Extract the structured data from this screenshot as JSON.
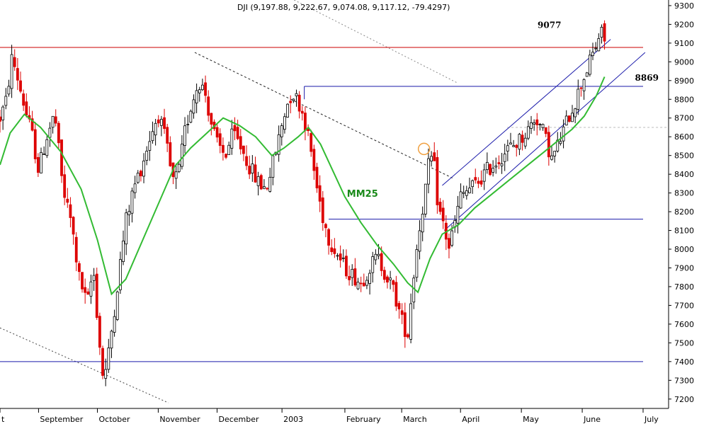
{
  "chart_data": {
    "type": "candlestick",
    "title": "DJI (9,197.88, 9,222.67, 9,074.08, 9,117.12, -79.4297)",
    "ylim": [
      7150,
      9330
    ],
    "y_ticks": [
      7200,
      7300,
      7400,
      7500,
      7600,
      7700,
      7800,
      7900,
      8000,
      8100,
      8200,
      8300,
      8400,
      8500,
      8600,
      8700,
      8800,
      8900,
      9000,
      9100,
      9200,
      9300
    ],
    "x_tick_labels": [
      "t",
      "September",
      "October",
      "November",
      "December",
      "2003",
      "February",
      "March",
      "April",
      "May",
      "June",
      "July"
    ],
    "x_tick_days": [
      0,
      19,
      48,
      78,
      107,
      139,
      170,
      198,
      227,
      257,
      287,
      317
    ],
    "last_day": 298,
    "grid_y": [
      8650
    ],
    "candles_bars": 207,
    "horizontal_levels": [
      {
        "value": 9077,
        "label": "9077",
        "color": "#cc0000",
        "from_day": 0,
        "to_day": 317
      },
      {
        "value": 8869,
        "label": "8869",
        "color": "#1a1aaa",
        "from_day": 150,
        "to_day": 317
      },
      {
        "value": 8160,
        "label": "",
        "color": "#1a1aaa",
        "from_day": 162,
        "to_day": 317
      },
      {
        "value": 7400,
        "label": "",
        "color": "#1a1aaa",
        "from_day": 0,
        "to_day": 317
      }
    ],
    "moving_average_label": "MM25",
    "moving_average_color": "#33bb33",
    "moving_average": [
      [
        0,
        8450
      ],
      [
        5,
        8620
      ],
      [
        12,
        8720
      ],
      [
        20,
        8650
      ],
      [
        30,
        8520
      ],
      [
        40,
        8320
      ],
      [
        48,
        8050
      ],
      [
        55,
        7760
      ],
      [
        62,
        7840
      ],
      [
        70,
        8040
      ],
      [
        78,
        8240
      ],
      [
        86,
        8440
      ],
      [
        94,
        8540
      ],
      [
        102,
        8620
      ],
      [
        110,
        8700
      ],
      [
        118,
        8660
      ],
      [
        126,
        8600
      ],
      [
        134,
        8500
      ],
      [
        140,
        8540
      ],
      [
        147,
        8600
      ],
      [
        152,
        8650
      ],
      [
        158,
        8560
      ],
      [
        164,
        8420
      ],
      [
        170,
        8280
      ],
      [
        178,
        8140
      ],
      [
        186,
        8020
      ],
      [
        194,
        7920
      ],
      [
        201,
        7820
      ],
      [
        206,
        7770
      ],
      [
        212,
        7950
      ],
      [
        218,
        8080
      ],
      [
        226,
        8130
      ],
      [
        234,
        8220
      ],
      [
        242,
        8290
      ],
      [
        250,
        8360
      ],
      [
        258,
        8430
      ],
      [
        266,
        8500
      ],
      [
        274,
        8570
      ],
      [
        282,
        8640
      ],
      [
        288,
        8710
      ],
      [
        294,
        8820
      ],
      [
        298,
        8920
      ]
    ],
    "price_path": [
      [
        0,
        8700
      ],
      [
        3,
        8790
      ],
      [
        6,
        9030
      ],
      [
        9,
        8900
      ],
      [
        13,
        8720
      ],
      [
        16,
        8600
      ],
      [
        19,
        8420
      ],
      [
        23,
        8600
      ],
      [
        27,
        8720
      ],
      [
        31,
        8320
      ],
      [
        35,
        8150
      ],
      [
        39,
        7850
      ],
      [
        43,
        7700
      ],
      [
        46,
        7900
      ],
      [
        49,
        7500
      ],
      [
        51,
        7300
      ],
      [
        53,
        7400
      ],
      [
        56,
        7650
      ],
      [
        59,
        7900
      ],
      [
        62,
        8150
      ],
      [
        66,
        8330
      ],
      [
        70,
        8450
      ],
      [
        74,
        8600
      ],
      [
        78,
        8720
      ],
      [
        82,
        8560
      ],
      [
        85,
        8360
      ],
      [
        88,
        8400
      ],
      [
        91,
        8620
      ],
      [
        94,
        8760
      ],
      [
        98,
        8900
      ],
      [
        101,
        8840
      ],
      [
        104,
        8680
      ],
      [
        107,
        8560
      ],
      [
        111,
        8500
      ],
      [
        115,
        8620
      ],
      [
        119,
        8540
      ],
      [
        123,
        8440
      ],
      [
        127,
        8360
      ],
      [
        131,
        8320
      ],
      [
        135,
        8480
      ],
      [
        138,
        8620
      ],
      [
        141,
        8760
      ],
      [
        144,
        8840
      ],
      [
        147,
        8790
      ],
      [
        150,
        8700
      ],
      [
        153,
        8540
      ],
      [
        156,
        8340
      ],
      [
        159,
        8180
      ],
      [
        162,
        8060
      ],
      [
        166,
        7980
      ],
      [
        170,
        7900
      ],
      [
        174,
        7860
      ],
      [
        178,
        7820
      ],
      [
        182,
        7900
      ],
      [
        186,
        7960
      ],
      [
        190,
        7870
      ],
      [
        194,
        7780
      ],
      [
        198,
        7620
      ],
      [
        201,
        7540
      ],
      [
        203,
        7780
      ],
      [
        206,
        8060
      ],
      [
        209,
        8270
      ],
      [
        212,
        8500
      ],
      [
        214,
        8440
      ],
      [
        216,
        8220
      ],
      [
        219,
        8120
      ],
      [
        221,
        8000
      ],
      [
        224,
        8130
      ],
      [
        227,
        8280
      ],
      [
        231,
        8320
      ],
      [
        235,
        8350
      ],
      [
        240,
        8420
      ],
      [
        245,
        8470
      ],
      [
        250,
        8530
      ],
      [
        255,
        8570
      ],
      [
        260,
        8630
      ],
      [
        264,
        8710
      ],
      [
        268,
        8620
      ],
      [
        272,
        8480
      ],
      [
        276,
        8580
      ],
      [
        280,
        8700
      ],
      [
        284,
        8800
      ],
      [
        287,
        8900
      ],
      [
        290,
        8980
      ],
      [
        293,
        9060
      ],
      [
        296,
        9160
      ],
      [
        298,
        9120
      ]
    ],
    "trend_lines": [
      {
        "points": [
          [
            0,
            7580
          ],
          [
            83,
            7180
          ]
        ],
        "style": "dotted",
        "color": "#444444"
      },
      {
        "points": [
          [
            96,
            9050
          ],
          [
            223,
            8380
          ]
        ],
        "style": "dashed",
        "color": "#222222"
      },
      {
        "points": [
          [
            145,
            9330
          ],
          [
            225,
            8890
          ]
        ],
        "style": "dotted",
        "color": "#888888"
      },
      {
        "points": [
          [
            218,
            8340
          ],
          [
            301,
            9120
          ]
        ],
        "style": "solid",
        "color": "#1a1aaa"
      },
      {
        "points": [
          [
            219,
            8100
          ],
          [
            318,
            9050
          ]
        ],
        "style": "solid",
        "color": "#1a1aaa"
      }
    ],
    "highlight_circle": {
      "day": 209,
      "value": 8520,
      "color": "#f0a040"
    }
  }
}
